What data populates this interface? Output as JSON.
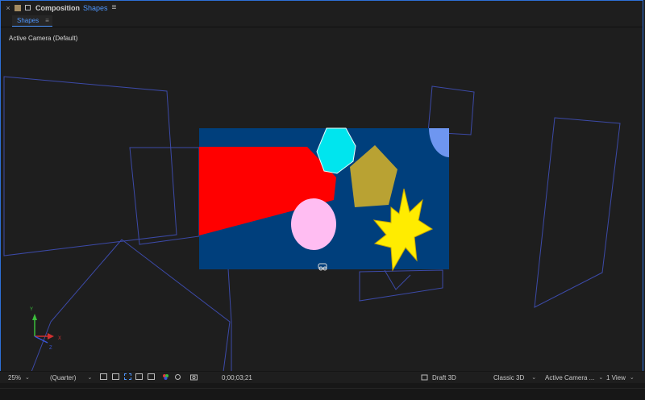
{
  "panel": {
    "close_glyph": "×",
    "title_prefix": "Composition",
    "comp_name": "Shapes",
    "menu_glyph": "≡",
    "tab_label": "Shapes",
    "tab_close": "≡"
  },
  "viewport": {
    "camera_label": "Active Camera (Default)",
    "axis_y": "Y",
    "axis_x": "X",
    "axis_z": "Z",
    "colors": {
      "comp_bg": "#003f7c",
      "red_shape": "#ff0000",
      "cyan_shape": "#00e5ee",
      "pentagon": "#b9a233",
      "ellipse": "#ffbdf2",
      "star": "#ffec00",
      "quarter_circle": "#6e96f0",
      "wireframe": "#3c4aa8"
    }
  },
  "toolbar": {
    "zoom": "25%",
    "resolution": "(Quarter)",
    "timecode": "0;00;03;21",
    "draft3d": "Draft 3D",
    "renderer": "Classic 3D",
    "camera": "Active Camera ...",
    "views": "1 View",
    "chevron": "⌄"
  },
  "icons": [
    "close-icon",
    "composition-icon",
    "lock-icon",
    "panel-menu-icon",
    "toggle-mask-icon",
    "roi-icon",
    "transparency-grid-icon",
    "safe-zones-icon",
    "channel-icon",
    "color-management-icon",
    "snapshot-icon",
    "show-snapshot-icon",
    "draft-3d-icon",
    "camera-gizmo-icon"
  ]
}
